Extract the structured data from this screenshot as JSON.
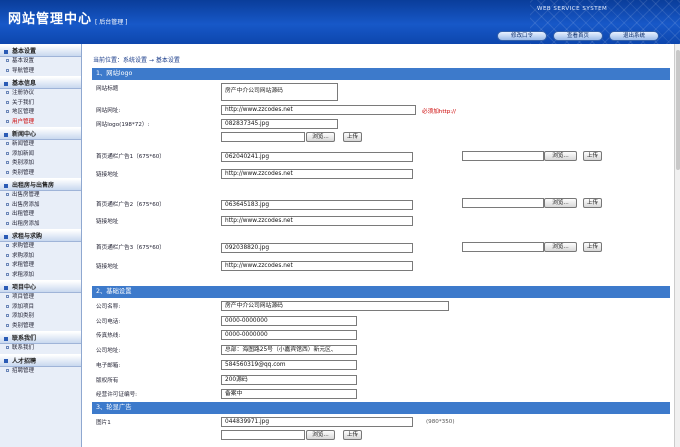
{
  "header": {
    "title": "网站管理中心",
    "subtitle": "[ 后台管理 ]",
    "brand": "WEB SERVICE SYSTEM",
    "buttons": [
      "修改口令",
      "查看首页",
      "退出系统"
    ]
  },
  "sidebar": [
    {
      "title": "基本设置",
      "items": [
        "基本设置",
        "导航管理"
      ]
    },
    {
      "title": "基本信息",
      "items": [
        "注册协议",
        "关于我们",
        "地区管理",
        "用户管理"
      ]
    },
    {
      "title": "新闻中心",
      "items": [
        "新闻管理",
        "添加新闻",
        "类别添加",
        "类别管理"
      ]
    },
    {
      "title": "出租房与出售房",
      "items": [
        "出售房管理",
        "出售房添加",
        "出租管理",
        "出租房添加"
      ]
    },
    {
      "title": "求租与求购",
      "items": [
        "求购管理",
        "求购添加",
        "求租管理",
        "求租添加"
      ]
    },
    {
      "title": "项目中心",
      "items": [
        "项目管理",
        "添加项目",
        "添加类别",
        "类别管理"
      ]
    },
    {
      "title": "联系我们",
      "items": [
        "联系我们"
      ]
    },
    {
      "title": "人才招聘",
      "items": [
        "招聘管理"
      ]
    }
  ],
  "breadcrumb": "当前位置：系统设置 → 基本设置",
  "sections": {
    "logo": "1、网站logo",
    "info": "2、基础设置",
    "ads": "3、轮显广告"
  },
  "form": {
    "site_title_label": "网站标题",
    "site_title_value": "房产中介公司网站源码",
    "site_url_label": "网站网址:",
    "site_url_value": "http://www.zzcodes.net",
    "site_url_note": "必须加http://",
    "logo_label": "网站logo(198*72）:",
    "logo_value": "082837345.jpg",
    "browse": "浏览...",
    "upload": "上传",
    "ad1_label": "首页通栏广告1（675*60）",
    "ad1_value": "062040241.jpg",
    "ad2_label": "首页通栏广告2（675*60）",
    "ad2_value": "063645183.jpg",
    "ad3_label": "首页通栏广告3（675*60）",
    "ad3_value": "092038820.jpg",
    "link_label": "链接地址",
    "link_value": "http://www.zzcodes.net",
    "company_name_label": "公司名称:",
    "company_name_value": "房产中介公司网站源码",
    "phone_label": "公司电话:",
    "phone_value": "0000-0000000",
    "fax_label": "传真热线:",
    "fax_value": "0000-0000000",
    "address_label": "公司地址:",
    "address_value": "总部：海图路25号（小嘉宾馆西）新元区、",
    "email_label": "电子邮箱:",
    "email_value": "584560319@qq.com",
    "copyright_label": "版权所有",
    "copyright_value": "200源码",
    "license_label": "经营许可证编号:",
    "license_value": "备案中",
    "pic_label": "图片1",
    "pic_value": "044839971.jpg",
    "pic_note": "(980*350)"
  },
  "colors": {
    "header": "#1758c8",
    "section": "#3d7acb",
    "sidebar": "#e8eef8",
    "accent_red": "#cc0000"
  }
}
